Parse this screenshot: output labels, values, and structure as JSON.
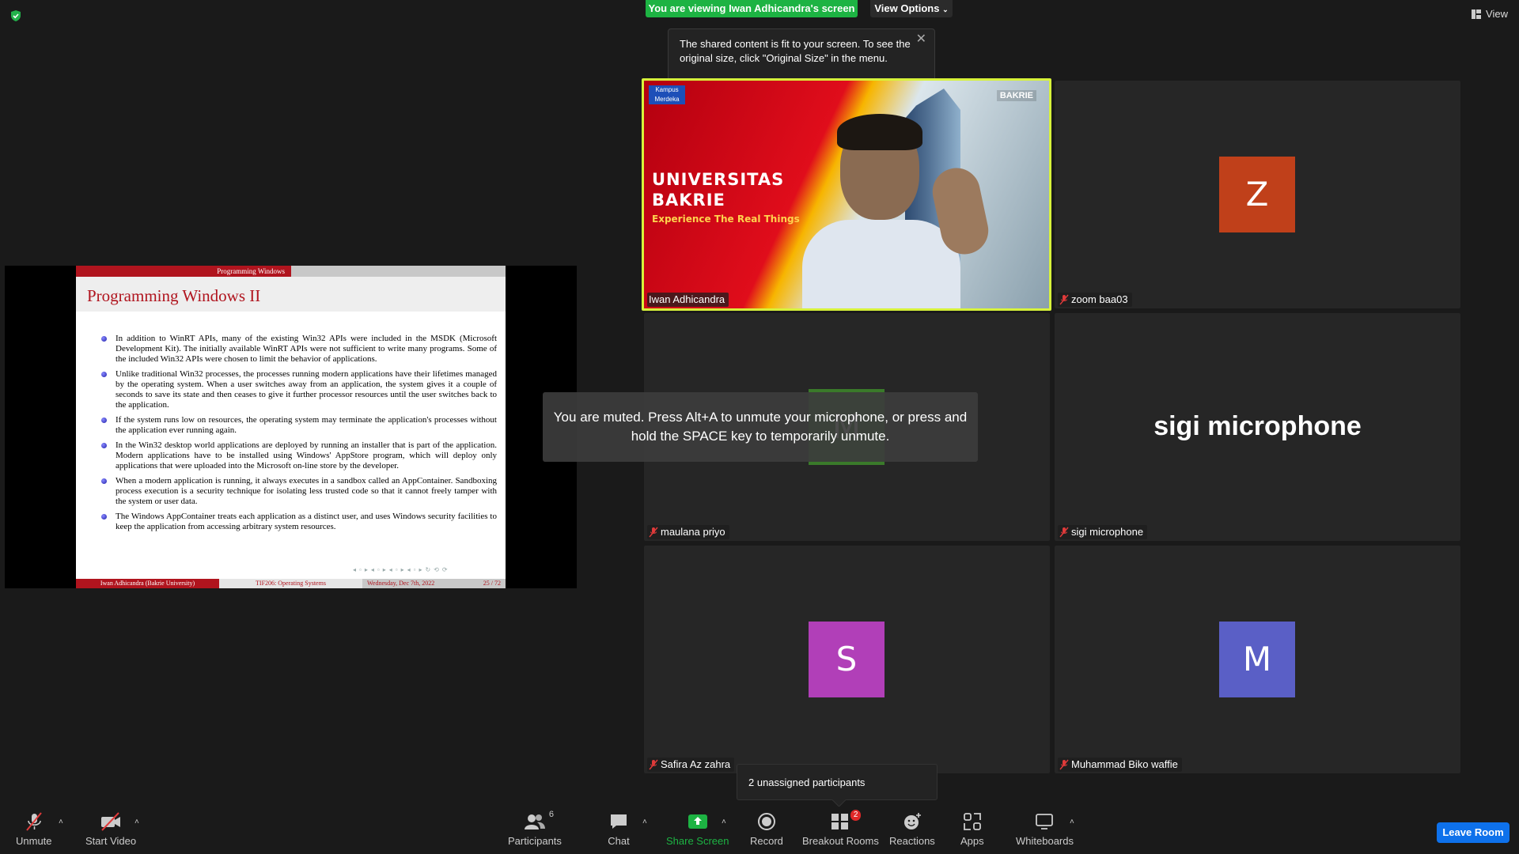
{
  "top": {
    "viewing_banner": "You are viewing Iwan Adhicandra's screen",
    "view_options": "View Options",
    "view_button": "View"
  },
  "tooltip": {
    "text": "The shared content is fit to your screen. To see the original size, click \"Original Size\" in the menu."
  },
  "slide": {
    "header": "Programming Windows",
    "title": "Programming Windows II",
    "bullets": [
      "In addition to WinRT APIs, many of the existing Win32 APIs were included in the MSDK (Microsoft Development Kit). The initially available WinRT APIs were not sufficient to write many programs. Some of the included Win32 APIs were chosen to limit the behavior of applications.",
      "Unlike traditional Win32 processes, the processes running modern applications have their lifetimes managed by the operating system. When a user switches away from an application, the system gives it a couple of seconds to save its state and then ceases to give it further processor resources until the user switches back to the application.",
      "If the system runs low on resources, the operating system may terminate the application's processes without the application ever running again.",
      "In the Win32 desktop world applications are deployed by running an installer that is part of the application. Modern applications have to be installed using Windows' AppStore program, which will deploy only applications that were uploaded into the Microsoft on-line store by the developer.",
      "When a modern application is running, it always executes in a sandbox called an AppContainer. Sandboxing process execution is a security technique for isolating less trusted code so that it cannot freely tamper with the system or user data.",
      "The Windows AppContainer treats each application as a distinct user, and uses Windows security facilities to keep the application from accessing arbitrary system resources."
    ],
    "footer_author": "Iwan Adhicandra (Bakrie University)",
    "footer_course": "TIF206: Operating Systems",
    "footer_date": "Wednesday, Dec 7th, 2022",
    "footer_page": "25 / 72"
  },
  "participants_tiles": {
    "iwan": {
      "name": "Iwan Adhicandra",
      "bg_title": "UNIVERSITAS BAKRIE",
      "bg_tagline": "Experience The Real Things",
      "bg_logo": "BAKRIE"
    },
    "zoom": {
      "name": "zoom baa03",
      "initial": "Z",
      "color": "#c0401a"
    },
    "maulana": {
      "name": "maulana priyo",
      "initial": "M",
      "color": "#3a7a2a"
    },
    "sigi": {
      "name": "sigi microphone",
      "big_name": "sigi microphone"
    },
    "safira": {
      "name": "Safira Az zahra",
      "initial": "S",
      "color": "#b13fb8"
    },
    "biko": {
      "name": "Muhammad Biko waffie",
      "initial": "M",
      "color": "#5a5fc6"
    }
  },
  "toast": {
    "muted": "You are muted. Press Alt+A to unmute your microphone, or press and hold the SPACE key to temporarily unmute."
  },
  "unassigned": "2 unassigned participants",
  "toolbar": {
    "unmute": "Unmute",
    "start_video": "Start Video",
    "participants": "Participants",
    "participants_count": "6",
    "chat": "Chat",
    "share_screen": "Share Screen",
    "record": "Record",
    "breakout_rooms": "Breakout Rooms",
    "breakout_count": "2",
    "reactions": "Reactions",
    "apps": "Apps",
    "whiteboards": "Whiteboards",
    "leave_room": "Leave Room"
  }
}
